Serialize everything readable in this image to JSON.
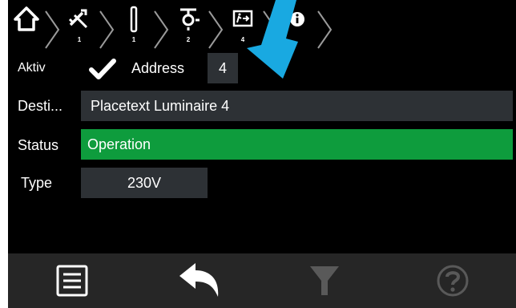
{
  "breadcrumb": {
    "items": [
      {
        "icon": "home-icon",
        "count": ""
      },
      {
        "icon": "no-connection-icon",
        "count": "1"
      },
      {
        "icon": "bar-icon",
        "count": "1"
      },
      {
        "icon": "lamp-icon",
        "count": "2"
      },
      {
        "icon": "exit-sign-icon",
        "count": "4"
      },
      {
        "icon": "info-icon",
        "count": ""
      }
    ]
  },
  "form": {
    "active_label": "Aktiv",
    "address_label": "Address",
    "address_value": "4",
    "destination_label": "Desti...",
    "destination_value": "Placetext Luminaire 4",
    "status_label": "Status",
    "status_value": "Operation",
    "type_label": "Type",
    "type_value": "230V"
  },
  "colors": {
    "background": "#000000",
    "field": "#2d3135",
    "status_ok": "#0e9c3d",
    "arrow": "#19a9e1",
    "bottom_bar": "#262626"
  },
  "bottombar": {
    "buttons": [
      "menu-icon",
      "back-icon",
      "filter-icon",
      "help-icon"
    ]
  }
}
